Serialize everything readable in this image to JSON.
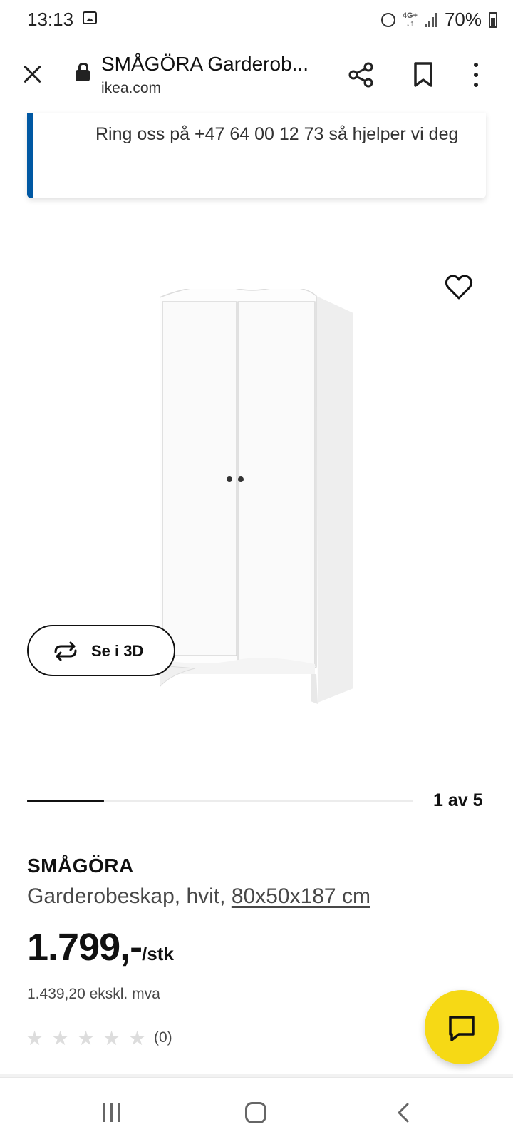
{
  "status_bar": {
    "time": "13:13",
    "network": "4G+",
    "battery": "70%"
  },
  "browser": {
    "page_title": "SMÅGÖRA Garderob...",
    "domain": "ikea.com"
  },
  "info_banner": {
    "text": "Ring oss på +47 64 00 12 73 så hjelper vi deg",
    "accent_color": "#0058a3"
  },
  "product_view": {
    "view_3d_label": "Se i 3D",
    "carousel_counter": "1 av 5",
    "carousel_progress": 0.2
  },
  "product": {
    "name": "SMÅGÖRA",
    "description": "Garderobeskap, hvit, ",
    "dimensions": "80x50x187 cm",
    "price": "1.799,-",
    "price_unit": "/stk",
    "price_ex_vat": "1.439,20 ekskl. mva",
    "rating_stars": 0,
    "review_count": "(0)"
  },
  "icons": {
    "close": "close-icon",
    "lock": "lock-icon",
    "share": "share-icon",
    "bookmark": "bookmark-icon",
    "more": "more-vertical-icon",
    "heart": "heart-icon",
    "rotate": "rotate-3d-icon",
    "chat": "chat-icon",
    "star": "star-icon"
  },
  "colors": {
    "chat_button": "#f6d915",
    "text_primary": "#111111",
    "text_secondary": "#484848"
  }
}
